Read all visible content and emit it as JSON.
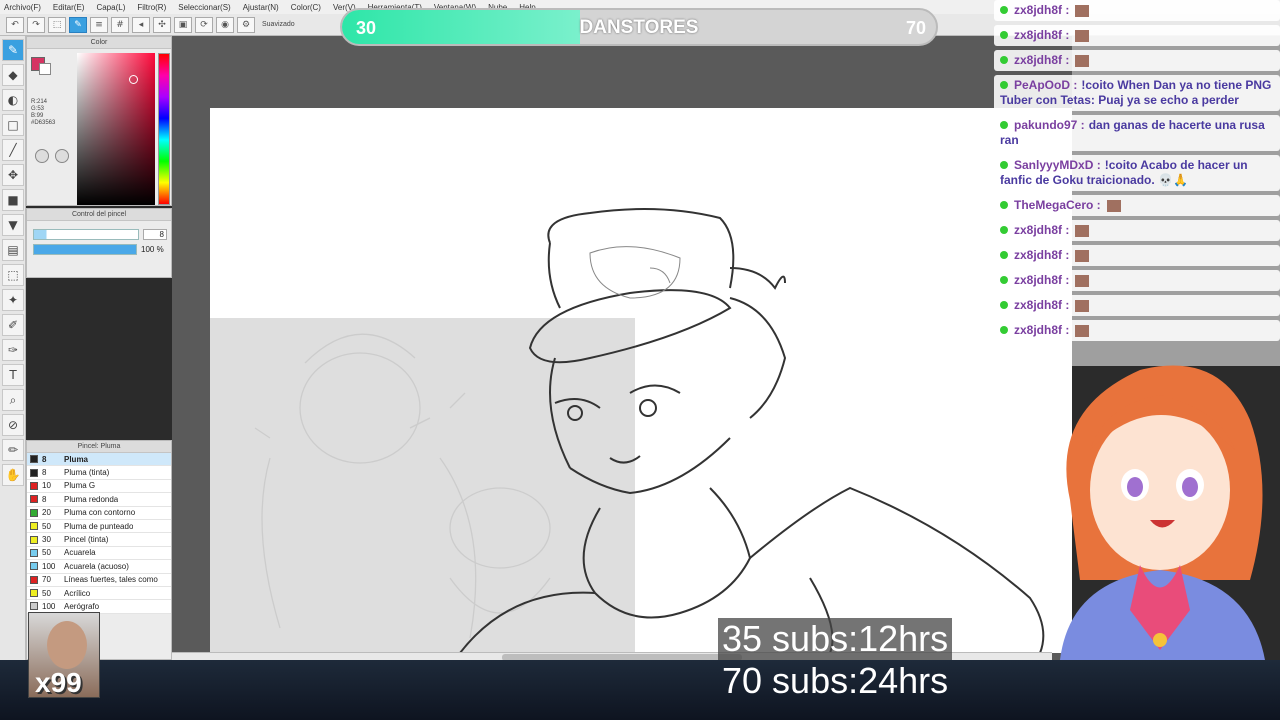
{
  "menu": [
    "Archivo(F)",
    "Editar(E)",
    "Capa(L)",
    "Filtro(R)",
    "Seleccionar(S)",
    "Ajustar(N)",
    "Color(C)",
    "Ver(V)",
    "Herramienta(T)",
    "Ventana(W)",
    "Nube",
    "Help"
  ],
  "toolbar": {
    "smoothing_label": "Suavizado"
  },
  "color_panel": {
    "title": "Color",
    "r": "R:214",
    "g": "G:53",
    "b": "B:99",
    "hex": "#D63563",
    "main_color": "#D63563"
  },
  "brush_control": {
    "title": "Control del pincel",
    "size": "8",
    "opacity": "100 %",
    "opacity_fraction": 1.0
  },
  "brush_list": {
    "title": "Pincel: Pluma",
    "items": [
      {
        "size": "8",
        "name": "Pluma",
        "color": "#222222"
      },
      {
        "size": "8",
        "name": "Pluma (tinta)",
        "color": "#222222"
      },
      {
        "size": "10",
        "name": "Pluma G",
        "color": "#dd2222"
      },
      {
        "size": "8",
        "name": "Pluma redonda",
        "color": "#dd2222"
      },
      {
        "size": "20",
        "name": "Pluma con contorno",
        "color": "#33aa33"
      },
      {
        "size": "50",
        "name": "Pluma de punteado",
        "color": "#eeee22"
      },
      {
        "size": "30",
        "name": "Pincel (tinta)",
        "color": "#eeee22"
      },
      {
        "size": "50",
        "name": "Acuarela",
        "color": "#77ccee"
      },
      {
        "size": "100",
        "name": "Acuarela (acuoso)",
        "color": "#77ccee"
      },
      {
        "size": "70",
        "name": "Líneas fuertes, tales como",
        "color": "#dd2222"
      },
      {
        "size": "50",
        "name": "Acrílico",
        "color": "#eeee22"
      },
      {
        "size": "100",
        "name": "Aerógrafo",
        "color": "#cccccc"
      }
    ]
  },
  "sub_goal": {
    "current": "30",
    "name": "DANSTORES",
    "target": "70",
    "progress_fraction": 0.4
  },
  "chat": [
    {
      "nick": "zx8jdh8f :",
      "msg": ""
    },
    {
      "nick": "zx8jdh8f :",
      "msg": ""
    },
    {
      "nick": "zx8jdh8f :",
      "msg": ""
    },
    {
      "nick": "PeApOoD :",
      "msg": "!coito When Dan ya no tiene PNG Tuber con Tetas: Puaj ya se echo a perder"
    },
    {
      "nick": "pakundo97 :",
      "msg": "dan ganas de hacerte una rusa ran"
    },
    {
      "nick": "SanlyyyMDxD :",
      "msg": "!coito Acabo de hacer un fanfic de Goku traicionado. 💀🙏"
    },
    {
      "nick": "TheMegaCero :",
      "msg": ""
    },
    {
      "nick": "zx8jdh8f :",
      "msg": ""
    },
    {
      "nick": "zx8jdh8f :",
      "msg": ""
    },
    {
      "nick": "zx8jdh8f :",
      "msg": ""
    },
    {
      "nick": "zx8jdh8f :",
      "msg": ""
    },
    {
      "nick": "zx8jdh8f :",
      "msg": ""
    }
  ],
  "subs_text": {
    "line1": "35 subs:12hrs",
    "line2": "70 subs:24hrs"
  },
  "webcam": {
    "multiplier": "x99"
  }
}
